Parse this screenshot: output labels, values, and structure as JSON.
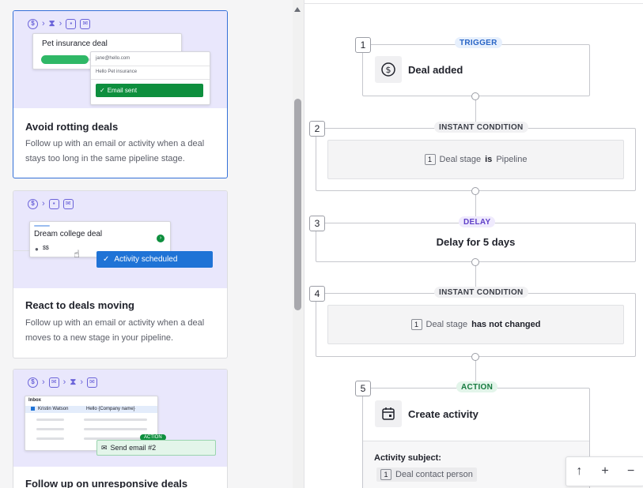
{
  "templates": [
    {
      "title": "Avoid rotting deals",
      "description": "Follow up with an email or activity when a deal stays too long in the same pipeline stage.",
      "illustration": {
        "deal_name": "Pet insurance deal",
        "email_from": "jane@hello.com",
        "email_subject": "Hello Pet insurance",
        "button_label": "Email sent"
      }
    },
    {
      "title": "React to deals moving",
      "description": "Follow up with an email or activity when a deal moves to a new stage in your pipeline.",
      "illustration": {
        "deal_name": "Dream college deal",
        "deal_value": "$$",
        "button_label": "Activity scheduled"
      }
    },
    {
      "title": "Follow up on unresponsive deals",
      "illustration": {
        "inbox_label": "Inbox",
        "sender": "Kristin Watson",
        "subject": "Hello {Company name}",
        "tag": "ACTION",
        "button_label": "Send email #2"
      }
    }
  ],
  "workflow": {
    "steps": [
      {
        "number": "1",
        "tag": "TRIGGER",
        "label": "Deal added"
      },
      {
        "number": "2",
        "tag": "INSTANT CONDITION",
        "chip": "1",
        "field": "Deal stage",
        "operator": "is",
        "value": "Pipeline"
      },
      {
        "number": "3",
        "tag": "DELAY",
        "label": "Delay for 5 days"
      },
      {
        "number": "4",
        "tag": "INSTANT CONDITION",
        "chip": "1",
        "field": "Deal stage",
        "operator": "has not changed"
      },
      {
        "number": "5",
        "tag": "ACTION",
        "label": "Create activity",
        "detail_label": "Activity subject:",
        "chip": "1",
        "detail_value": "Deal contact person"
      }
    ]
  },
  "zoom_controls": {
    "up": "↑",
    "plus": "+",
    "minus": "−"
  }
}
